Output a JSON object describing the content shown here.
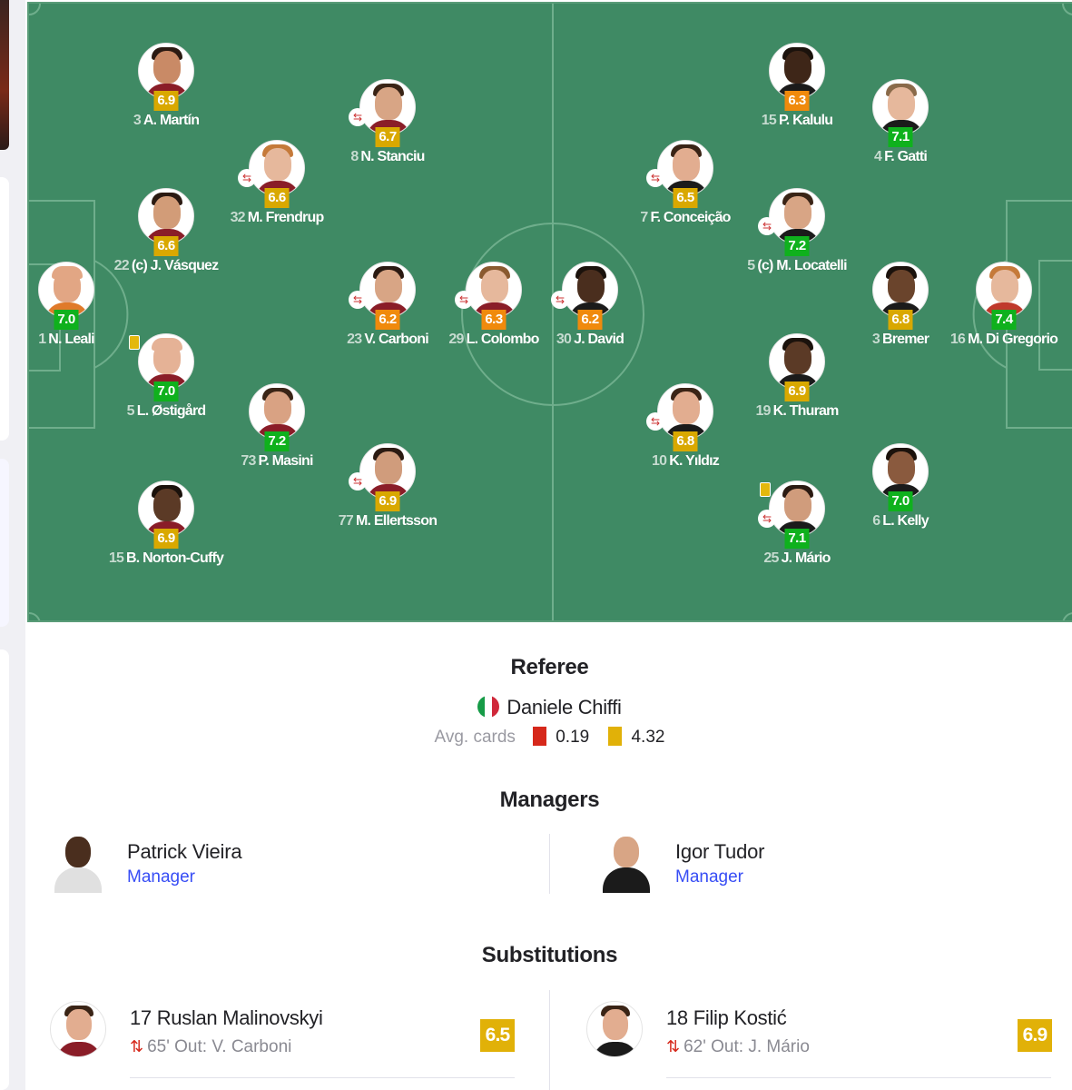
{
  "colors": {
    "rating_green": "#0fb11d",
    "rating_yellow": "#d9a800",
    "rating_orange": "#f08a0c",
    "pitch": "#3f8a64",
    "link": "#374df5"
  },
  "pitch": {
    "players": [
      {
        "id": "martin",
        "number": "3",
        "name": "A. Martín",
        "rating": "6.9",
        "rating_color": "yellow",
        "skin": "#c98a66",
        "hair": "#2b1a12",
        "kit": "#8a1d28"
      },
      {
        "id": "vasquez",
        "number": "22",
        "name": "(c) J. Vásquez",
        "rating": "6.6",
        "rating_color": "yellow",
        "skin": "#d29c78",
        "hair": "#2b1a12",
        "kit": "#8a1d28"
      },
      {
        "id": "leali",
        "number": "1",
        "name": "N. Leali",
        "rating": "7.0",
        "rating_color": "green",
        "skin": "#e2a684",
        "hair": "#e2a684",
        "kit": "#e07a2a"
      },
      {
        "id": "ostigard",
        "number": "5",
        "name": "L. Østigård",
        "rating": "7.0",
        "rating_color": "green",
        "skin": "#e5b296",
        "hair": "#e5b296",
        "kit": "#8a1d28",
        "card": "yellow"
      },
      {
        "id": "norton",
        "number": "15",
        "name": "B. Norton-Cuffy",
        "rating": "6.9",
        "rating_color": "yellow",
        "skin": "#5b3a26",
        "hair": "#1b120c",
        "kit": "#8a1d28"
      },
      {
        "id": "frendrup",
        "number": "32",
        "name": "M. Frendrup",
        "rating": "6.6",
        "rating_color": "yellow",
        "skin": "#e6b89c",
        "hair": "#c57a3a",
        "kit": "#8a1d28",
        "sub": true
      },
      {
        "id": "masini",
        "number": "73",
        "name": "P. Masini",
        "rating": "7.2",
        "rating_color": "green",
        "skin": "#d9a283",
        "hair": "#3a2416",
        "kit": "#8a1d28"
      },
      {
        "id": "stanciu",
        "number": "8",
        "name": "N. Stanciu",
        "rating": "6.7",
        "rating_color": "yellow",
        "skin": "#d8a585",
        "hair": "#3a2416",
        "kit": "#8a1d28",
        "sub": true
      },
      {
        "id": "carboni",
        "number": "23",
        "name": "V. Carboni",
        "rating": "6.2",
        "rating_color": "orange",
        "skin": "#d8a585",
        "hair": "#2b1a12",
        "kit": "#8a1d28",
        "sub": true
      },
      {
        "id": "ellertsson",
        "number": "77",
        "name": "M. Ellertsson",
        "rating": "6.9",
        "rating_color": "yellow",
        "skin": "#d09c7c",
        "hair": "#2b1a12",
        "kit": "#8a1d28",
        "sub": true
      },
      {
        "id": "colombo",
        "number": "29",
        "name": "L. Colombo",
        "rating": "6.3",
        "rating_color": "orange",
        "skin": "#e6b89c",
        "hair": "#8a5a30",
        "kit": "#8a1d28",
        "sub": true
      },
      {
        "id": "david",
        "number": "30",
        "name": "J. David",
        "rating": "6.2",
        "rating_color": "orange",
        "skin": "#4a2e1e",
        "hair": "#1b120c",
        "kit": "#1b1b1b",
        "sub": true
      },
      {
        "id": "conceicao",
        "number": "7",
        "name": "F. Conceição",
        "rating": "6.5",
        "rating_color": "yellow",
        "skin": "#e2ad90",
        "hair": "#3a2416",
        "kit": "#1b1b1b",
        "sub": true
      },
      {
        "id": "yildiz",
        "number": "10",
        "name": "K. Yıldız",
        "rating": "6.8",
        "rating_color": "yellow",
        "skin": "#e2ad90",
        "hair": "#3a2416",
        "kit": "#1b1b1b",
        "sub": true
      },
      {
        "id": "kalulu",
        "number": "15",
        "name": "P. Kalulu",
        "rating": "6.3",
        "rating_color": "orange",
        "skin": "#3e2618",
        "hair": "#1b120c",
        "kit": "#1b1b1b"
      },
      {
        "id": "locatelli",
        "number": "5",
        "name": "(c) M. Locatelli",
        "rating": "7.2",
        "rating_color": "green",
        "skin": "#d8a585",
        "hair": "#3a2416",
        "kit": "#1b1b1b",
        "sub": true
      },
      {
        "id": "thuram",
        "number": "19",
        "name": "K. Thuram",
        "rating": "6.9",
        "rating_color": "yellow",
        "skin": "#5b3a26",
        "hair": "#1b120c",
        "kit": "#1b1b1b"
      },
      {
        "id": "mario",
        "number": "25",
        "name": "J. Mário",
        "rating": "7.1",
        "rating_color": "green",
        "skin": "#d09c7c",
        "hair": "#2b1a12",
        "kit": "#1b1b1b",
        "sub": true,
        "card": "yellow"
      },
      {
        "id": "gatti",
        "number": "4",
        "name": "F. Gatti",
        "rating": "7.1",
        "rating_color": "green",
        "skin": "#e6b89c",
        "hair": "#8a6a4a",
        "kit": "#1b1b1b"
      },
      {
        "id": "bremer",
        "number": "3",
        "name": "Bremer",
        "rating": "6.8",
        "rating_color": "yellow",
        "skin": "#6a442c",
        "hair": "#1b120c",
        "kit": "#1b1b1b"
      },
      {
        "id": "kelly",
        "number": "6",
        "name": "L. Kelly",
        "rating": "7.0",
        "rating_color": "green",
        "skin": "#8a5a3e",
        "hair": "#1b120c",
        "kit": "#1b1b1b"
      },
      {
        "id": "digregorio",
        "number": "16",
        "name": "M. Di Gregorio",
        "rating": "7.4",
        "rating_color": "green",
        "skin": "#e6b89c",
        "hair": "#c57a3a",
        "kit": "#c0392b"
      }
    ]
  },
  "referee": {
    "title": "Referee",
    "name": "Daniele Chiffi",
    "flag_icon": "italy-flag-icon",
    "avg_label": "Avg. cards",
    "red_avg": "0.19",
    "yellow_avg": "4.32"
  },
  "managers": {
    "title": "Managers",
    "items": [
      {
        "name": "Patrick Vieira",
        "role": "Manager"
      },
      {
        "name": "Igor Tudor",
        "role": "Manager"
      }
    ]
  },
  "substitutions": {
    "title": "Substitutions",
    "items": [
      {
        "number": "17",
        "name": "Ruslan Malinovskyi",
        "minute": "65'",
        "out_label": "Out:",
        "out_player": "V. Carboni",
        "rating": "6.5"
      },
      {
        "number": "18",
        "name": "Filip Kostić",
        "minute": "62'",
        "out_label": "Out:",
        "out_player": "J. Mário",
        "rating": "6.9"
      }
    ]
  }
}
